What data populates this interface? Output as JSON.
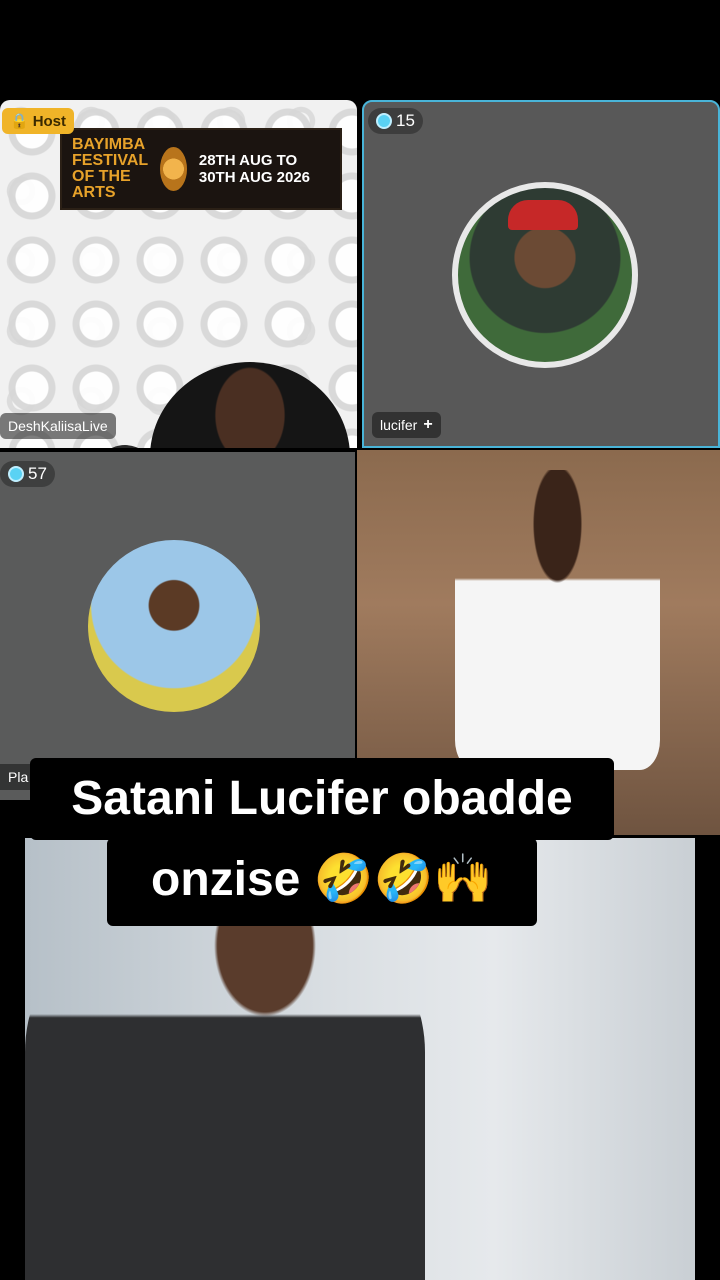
{
  "host_tile": {
    "badge": "Host",
    "name": "DeshKaliisaLive",
    "banner": {
      "title": "BAYIMBA FESTIVAL OF THE ARTS",
      "dates": "28TH AUG TO 30TH AUG 2026"
    }
  },
  "guest_tiles": [
    {
      "count": "15",
      "name": "lucifer",
      "action_icon": "plus-icon",
      "avatar_icon": "user-avatar"
    },
    {
      "count": "57",
      "name": "Pla",
      "avatar_icon": "user-avatar"
    },
    {
      "name": "",
      "type": "video"
    }
  ],
  "caption": {
    "line1": "Satani Lucifer obadde",
    "line2": "onzise 🤣🤣🙌"
  },
  "colors": {
    "active_border": "#49b4d8",
    "host_badge": "#f0b428",
    "banner_title": "#e7a22a",
    "caption_bg": "#000000"
  }
}
